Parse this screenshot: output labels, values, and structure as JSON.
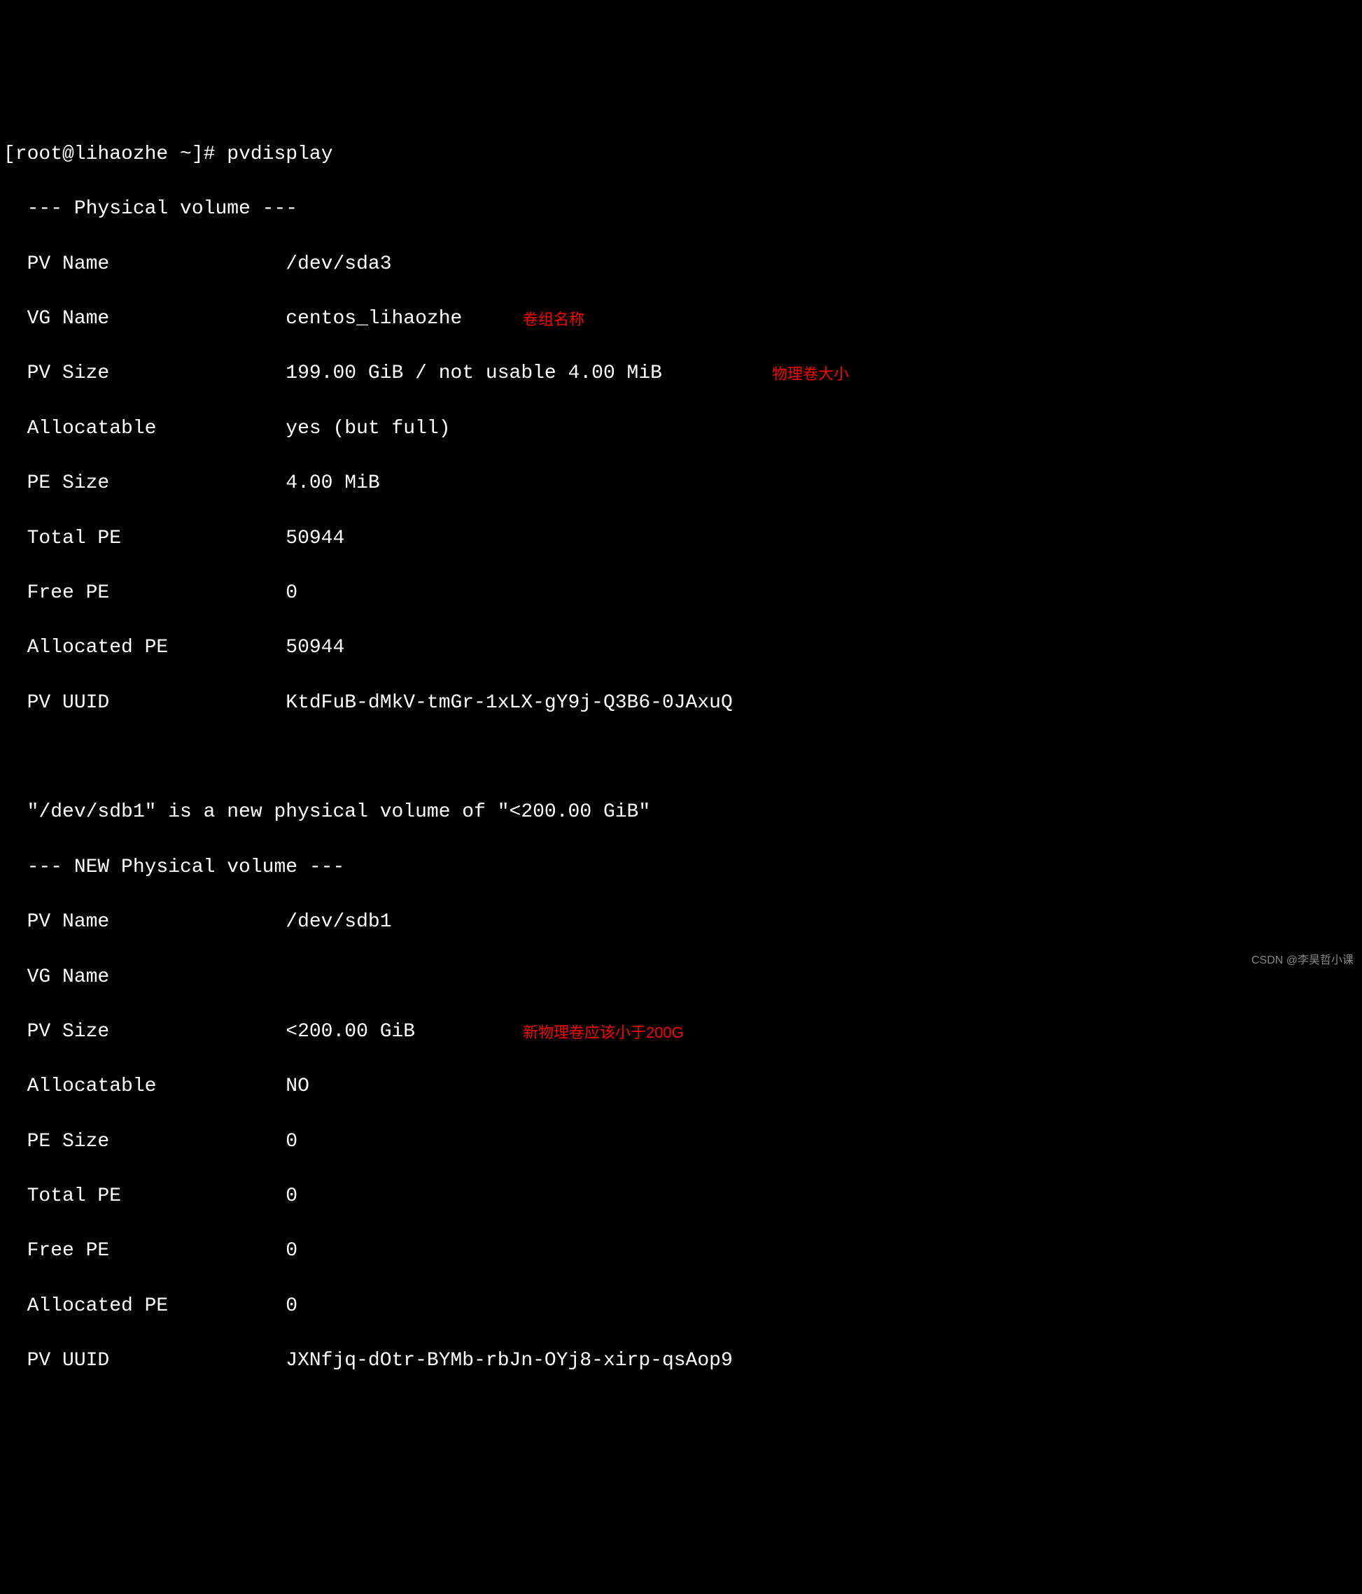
{
  "prompt": "[root@lihaozhe ~]# ",
  "command": "pvdisplay",
  "annotations": {
    "vg_name": "卷组名称",
    "pv_size": "物理卷大小",
    "new_pv_size": "新物理卷应该小于200G"
  },
  "volume1": {
    "header": "  --- Physical volume ---",
    "pv_name_label": "  PV Name               ",
    "pv_name_value": "/dev/sda3",
    "vg_name_label": "  VG Name               ",
    "vg_name_value": "centos_lihaozhe",
    "pv_size_label": "  PV Size               ",
    "pv_size_value": "199.00 GiB / not usable 4.00 MiB",
    "allocatable_label": "  Allocatable           ",
    "allocatable_value": "yes (but full)",
    "pe_size_label": "  PE Size               ",
    "pe_size_value": "4.00 MiB",
    "total_pe_label": "  Total PE              ",
    "total_pe_value": "50944",
    "free_pe_label": "  Free PE               ",
    "free_pe_value": "0",
    "allocated_pe_label": "  Allocated PE          ",
    "allocated_pe_value": "50944",
    "pv_uuid_label": "  PV UUID               ",
    "pv_uuid_value": "KtdFuB-dMkV-tmGr-1xLX-gY9j-Q3B6-0JAxuQ"
  },
  "volume2": {
    "notice": "  \"/dev/sdb1\" is a new physical volume of \"<200.00 GiB\"",
    "header": "  --- NEW Physical volume ---",
    "pv_name_label": "  PV Name               ",
    "pv_name_value": "/dev/sdb1",
    "vg_name_label": "  VG Name               ",
    "vg_name_value": "",
    "pv_size_label": "  PV Size               ",
    "pv_size_value": "<200.00 GiB",
    "allocatable_label": "  Allocatable           ",
    "allocatable_value": "NO",
    "pe_size_label": "  PE Size               ",
    "pe_size_value": "0",
    "total_pe_label": "  Total PE              ",
    "total_pe_value": "0",
    "free_pe_label": "  Free PE               ",
    "free_pe_value": "0",
    "allocated_pe_label": "  Allocated PE          ",
    "allocated_pe_value": "0",
    "pv_uuid_label": "  PV UUID               ",
    "pv_uuid_value": "JXNfjq-dOtr-BYMb-rbJn-OYj8-xirp-qsAop9"
  },
  "watermark": "CSDN @李昊哲小课"
}
